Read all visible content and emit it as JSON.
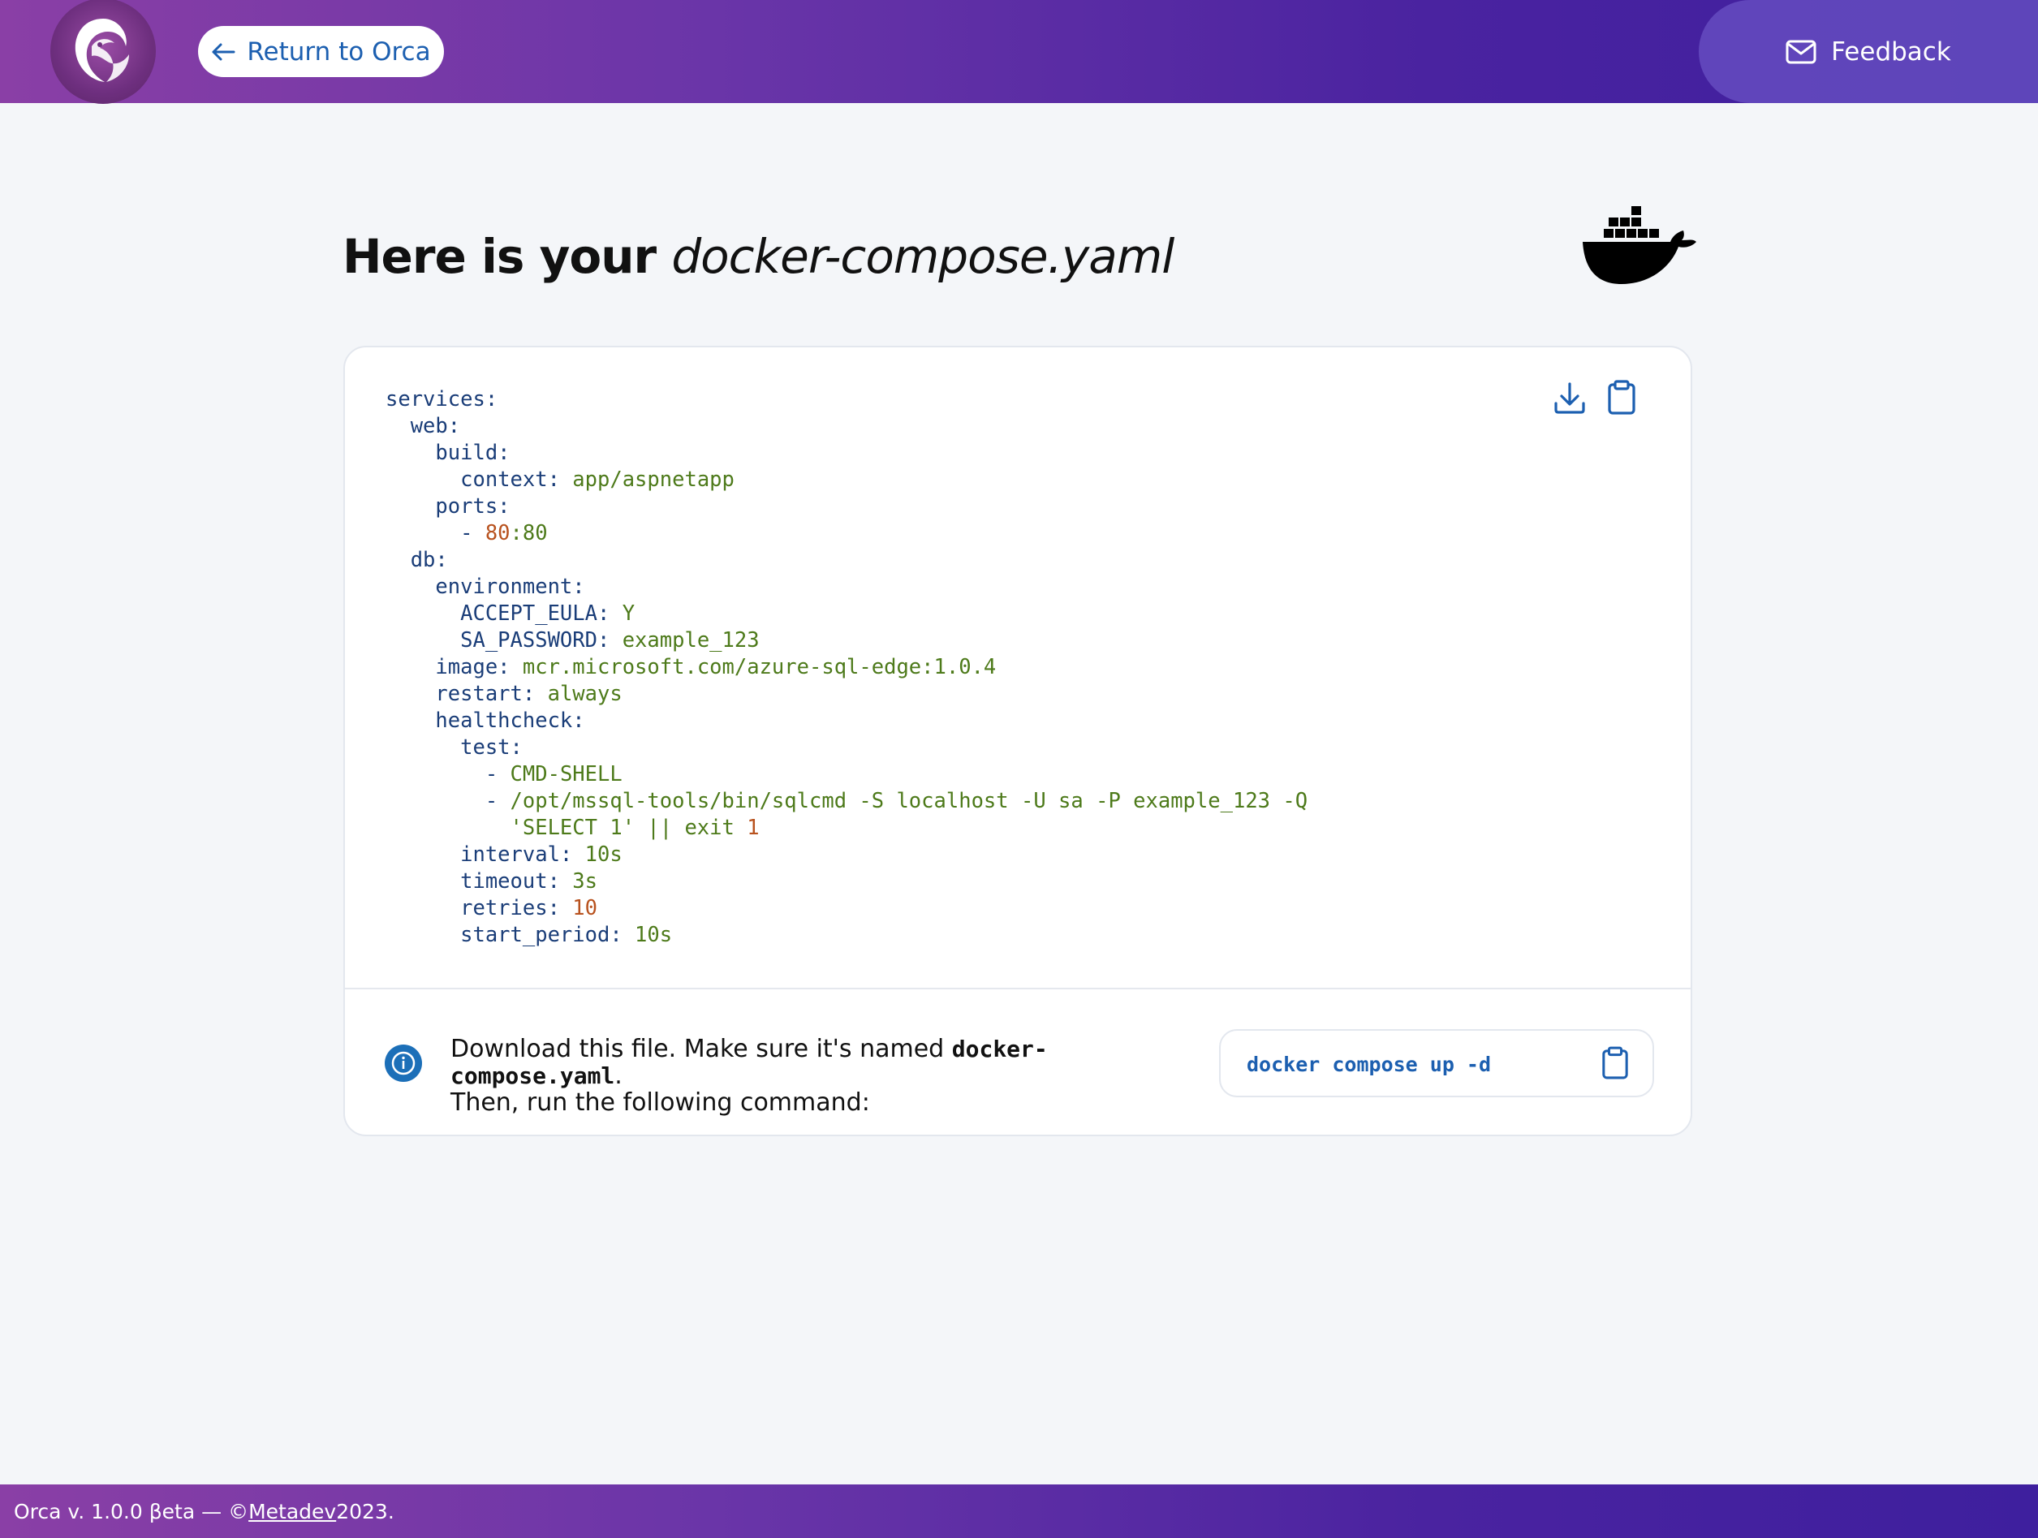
{
  "header": {
    "logo_icon": "orca-logo",
    "return_label": "Return to Orca",
    "feedback_label": "Feedback"
  },
  "title": {
    "prefix": "Here is your",
    "filename": "docker-compose.yaml"
  },
  "code": {
    "lines": [
      [
        {
          "t": "services:",
          "c": "k"
        }
      ],
      [
        {
          "t": "  web:",
          "c": "k"
        }
      ],
      [
        {
          "t": "    build:",
          "c": "k"
        }
      ],
      [
        {
          "t": "      context: ",
          "c": "k"
        },
        {
          "t": "app/aspnetapp",
          "c": "s"
        }
      ],
      [
        {
          "t": "    ports:",
          "c": "k"
        }
      ],
      [
        {
          "t": "      - ",
          "c": "k"
        },
        {
          "t": "80",
          "c": "n"
        },
        {
          "t": ":80",
          "c": "s"
        }
      ],
      [
        {
          "t": "  db:",
          "c": "k"
        }
      ],
      [
        {
          "t": "    environment:",
          "c": "k"
        }
      ],
      [
        {
          "t": "      ACCEPT_EULA: ",
          "c": "k"
        },
        {
          "t": "Y",
          "c": "s"
        }
      ],
      [
        {
          "t": "      SA_PASSWORD: ",
          "c": "k"
        },
        {
          "t": "example_123",
          "c": "s"
        }
      ],
      [
        {
          "t": "    image: ",
          "c": "k"
        },
        {
          "t": "mcr.microsoft.com/azure-sql-edge:1.0.4",
          "c": "s"
        }
      ],
      [
        {
          "t": "    restart: ",
          "c": "k"
        },
        {
          "t": "always",
          "c": "s"
        }
      ],
      [
        {
          "t": "    healthcheck:",
          "c": "k"
        }
      ],
      [
        {
          "t": "      test:",
          "c": "k"
        }
      ],
      [
        {
          "t": "        - ",
          "c": "k"
        },
        {
          "t": "CMD-SHELL",
          "c": "s"
        }
      ],
      [
        {
          "t": "        - ",
          "c": "k"
        },
        {
          "t": "/opt/mssql-tools/bin/sqlcmd -S localhost -U sa -P example_123 -Q",
          "c": "s"
        }
      ],
      [
        {
          "t": "          'SELECT 1' || exit ",
          "c": "s"
        },
        {
          "t": "1",
          "c": "n"
        }
      ],
      [
        {
          "t": "      interval: ",
          "c": "k"
        },
        {
          "t": "10s",
          "c": "s"
        }
      ],
      [
        {
          "t": "      timeout: ",
          "c": "k"
        },
        {
          "t": "3s",
          "c": "s"
        }
      ],
      [
        {
          "t": "      retries: ",
          "c": "k"
        },
        {
          "t": "10",
          "c": "n"
        }
      ],
      [
        {
          "t": "      start_period: ",
          "c": "k"
        },
        {
          "t": "10s",
          "c": "s"
        }
      ]
    ],
    "download_icon": "download-icon",
    "copy_icon": "clipboard-icon"
  },
  "info": {
    "text_part1": "Download this file. Make sure it's named ",
    "filename": "docker-compose.yaml",
    "text_part2": ".",
    "text_line2": "Then, run the following command:",
    "command": "docker compose up -d"
  },
  "footer": {
    "prefix": "Orca v. 1.0.0 βeta — © ",
    "link": "Metadev",
    "suffix": " 2023."
  },
  "colors": {
    "accent": "#1c5fb0",
    "header_start": "#8a3fa6",
    "header_end": "#3e1f9e"
  }
}
